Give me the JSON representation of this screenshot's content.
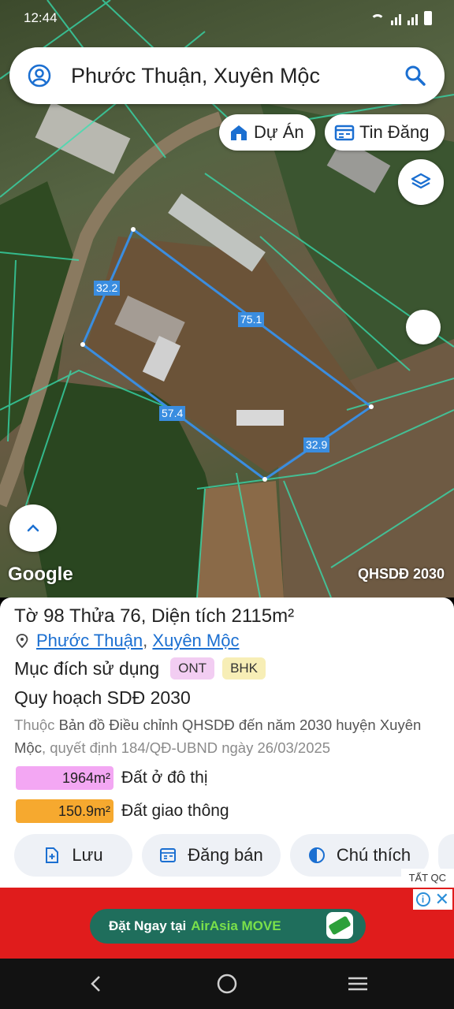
{
  "status_bar": {
    "time": "12:44"
  },
  "search": {
    "text": "Phước Thuận, Xuyên Mộc"
  },
  "map_buttons": {
    "du_an": "Dự Án",
    "tin_dang": "Tin Đăng"
  },
  "parcel_dimensions": [
    "32.2",
    "75.1",
    "57.4",
    "32.9"
  ],
  "map_footer": {
    "logo": "Google",
    "plan": "QHSDĐ 2030"
  },
  "panel": {
    "title": "Tờ 98 Thửa 76, Diện tích 2115m²",
    "location": {
      "ward": "Phước Thuận",
      "district": "Xuyên Mộc"
    },
    "purpose_label": "Mục đích sử dụng",
    "purpose_codes": [
      "ONT",
      "BHK"
    ],
    "plan_title": "Quy hoạch SDĐ 2030",
    "desc_prefix": "Thuộc",
    "desc_main": "Bản đồ Điều chỉnh QHSDĐ đến năm 2030 huyện Xuyên Mộc",
    "desc_suffix": ", quyết định 184/QĐ-UBND ngày 26/03/2025",
    "land_use": [
      {
        "area": "1964m²",
        "name": "Đất ở đô thị",
        "color": "#f3a7f3"
      },
      {
        "area": "150.9m²",
        "name": "Đất giao thông",
        "color": "#f6a92f"
      }
    ],
    "actions": {
      "save": "Lưu",
      "post": "Đăng bán",
      "legend": "Chú thích"
    }
  },
  "ad": {
    "label": "TẤT QC",
    "cta": "Đặt Ngay tại",
    "brand": "AirAsia MOVE",
    "background": "#e01c1c"
  },
  "colors": {
    "accent_blue": "#1b6fd1",
    "parcel_outline": "#3a8de0"
  }
}
